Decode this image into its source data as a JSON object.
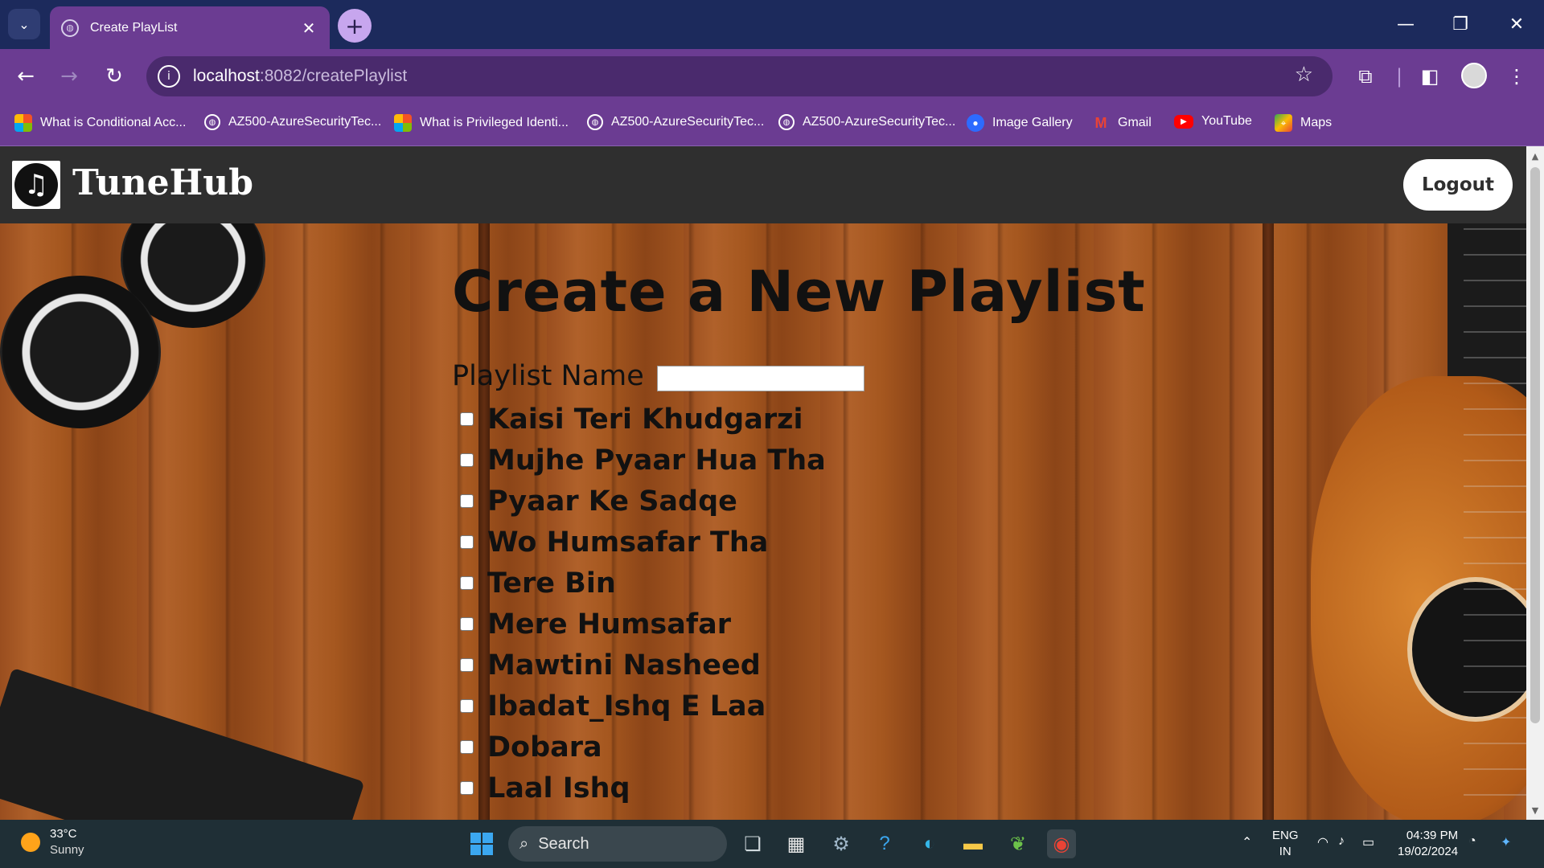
{
  "browser": {
    "tab_title": "Create PlayList",
    "url_host": "localhost",
    "url_path": ":8082/createPlaylist",
    "bookmarks": [
      {
        "label": "What is Conditional Acc...",
        "icon": "microsoft-icon"
      },
      {
        "label": "AZ500-AzureSecurityTec...",
        "icon": "globe-icon"
      },
      {
        "label": "What is Privileged Identi...",
        "icon": "microsoft-icon"
      },
      {
        "label": "AZ500-AzureSecurityTec...",
        "icon": "globe-icon"
      },
      {
        "label": "AZ500-AzureSecurityTec...",
        "icon": "globe-icon"
      },
      {
        "label": "Image Gallery",
        "icon": "drop-icon"
      },
      {
        "label": "Gmail",
        "icon": "gmail-icon"
      },
      {
        "label": "YouTube",
        "icon": "youtube-icon"
      },
      {
        "label": "Maps",
        "icon": "maps-icon"
      }
    ]
  },
  "navbar": {
    "brand": "TuneHub",
    "logout_label": "Logout"
  },
  "form": {
    "heading": "Create a New Playlist",
    "name_label": "Playlist Name",
    "name_value": "",
    "songs": [
      "Kaisi Teri Khudgarzi",
      "Mujhe Pyaar Hua Tha",
      "Pyaar Ke Sadqe",
      "Wo Humsafar Tha",
      "Tere Bin",
      "Mere Humsafar",
      "Mawtini Nasheed",
      "Ibadat_Ishq E Laa",
      "Dobara",
      "Laal Ishq"
    ]
  },
  "taskbar": {
    "temperature": "33°C",
    "weather": "Sunny",
    "search_label": "Search",
    "lang_top": "ENG",
    "lang_bottom": "IN",
    "time": "04:39 PM",
    "date": "19/02/2024"
  },
  "colors": {
    "tabbar": "#1c2a5c",
    "toolbar": "#6b3c92",
    "navbar": "#2f2f2f",
    "wood": "#9a4e1f"
  }
}
